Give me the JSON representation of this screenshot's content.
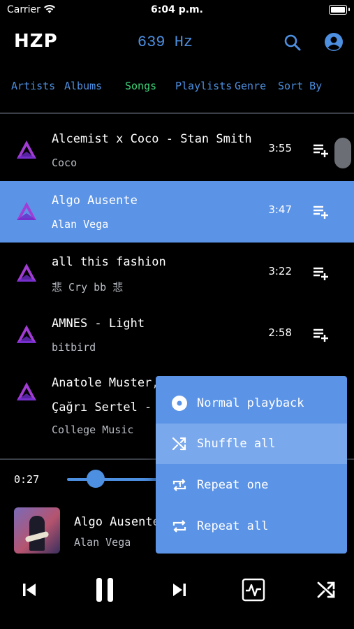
{
  "status_bar": {
    "carrier": "Carrier",
    "time": "6:04 p.m."
  },
  "header": {
    "logo": "HZP",
    "frequency": "639 Hz"
  },
  "tabs": [
    {
      "label": "Artists",
      "active": false
    },
    {
      "label": "Albums",
      "active": false
    },
    {
      "label": "Songs",
      "active": true
    },
    {
      "label": "Playlists",
      "active": false
    },
    {
      "label": "Genre",
      "active": false
    },
    {
      "label": "Sort By",
      "active": false
    }
  ],
  "songs": [
    {
      "title": "Alcemist x Coco - Stan Smith",
      "artist": "Coco",
      "duration": "3:55",
      "selected": false
    },
    {
      "title": "Algo Ausente",
      "artist": "Alan Vega",
      "duration": "3:47",
      "selected": true
    },
    {
      "title": "all this fashion",
      "artist": "悲 Cry bb 悲",
      "duration": "3:22",
      "selected": false
    },
    {
      "title": "AMNES - Light",
      "artist": "bitbird",
      "duration": "2:58",
      "selected": false
    },
    {
      "title": "Anatole Muster, A",
      "title2": "Çağrı Sertel - Cabl",
      "artist": "College Music",
      "duration": "",
      "selected": false
    }
  ],
  "player": {
    "elapsed": "0:27",
    "progress": 0.11,
    "title": "Algo Ausente",
    "artist": "Alan Vega"
  },
  "playback_menu": {
    "items": [
      {
        "label": "Normal playback",
        "icon": "disc-icon",
        "highlighted": false
      },
      {
        "label": "Shuffle all",
        "icon": "shuffle-icon",
        "highlighted": true
      },
      {
        "label": "Repeat one",
        "icon": "repeat-one-icon",
        "highlighted": false
      },
      {
        "label": "Repeat all",
        "icon": "repeat-icon",
        "highlighted": false
      }
    ]
  },
  "colors": {
    "accent": "#4d8fe0",
    "active_tab": "#3ed67a",
    "selected_row": "#5b93e6",
    "menu": "#5b93e6"
  }
}
